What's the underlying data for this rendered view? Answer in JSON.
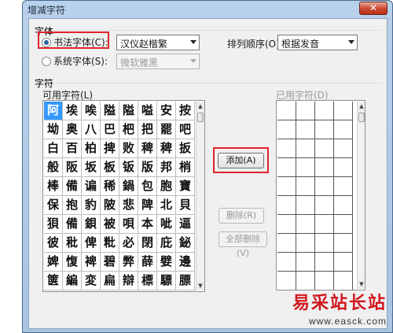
{
  "window": {
    "title": "增减字符",
    "close_label": "✕"
  },
  "font_group": {
    "label": "字体",
    "calligraphy_radio": {
      "label": "书法字体(C):",
      "checked": true
    },
    "calligraphy_select": {
      "value": "汉仪赵楷繁"
    },
    "system_radio": {
      "label": "系统字体(S):",
      "checked": false
    },
    "system_select": {
      "value": "微软雅黑"
    },
    "sort_label": "排列顺序(O):",
    "sort_select": {
      "value": "根据发音"
    }
  },
  "char_group": {
    "label": "字符",
    "available_label": "可用字符(L)",
    "used_label": "已用字符(D)",
    "available_chars": [
      [
        "阿",
        "埃",
        "唉",
        "隘",
        "隘",
        "嗌",
        "安",
        "按"
      ],
      [
        "坳",
        "奥",
        "八",
        "巴",
        "杷",
        "把",
        "罷",
        "吧"
      ],
      [
        "白",
        "百",
        "柏",
        "捭",
        "败",
        "稗",
        "稗",
        "扳"
      ],
      [
        "般",
        "阪",
        "坂",
        "板",
        "钣",
        "版",
        "邦",
        "梢"
      ],
      [
        "棒",
        "備",
        "谝",
        "稀",
        "鍋",
        "包",
        "胞",
        "寶"
      ],
      [
        "保",
        "抱",
        "豹",
        "陂",
        "悲",
        "陴",
        "北",
        "貝"
      ],
      [
        "狽",
        "備",
        "鋇",
        "被",
        "唄",
        "本",
        "呲",
        "逼"
      ],
      [
        "彼",
        "秕",
        "俾",
        "粃",
        "必",
        "閉",
        "庇",
        "鉍"
      ],
      [
        "婢",
        "愎",
        "裨",
        "碧",
        "弊",
        "薛",
        "嬖",
        "邊"
      ],
      [
        "箧",
        "編",
        "変",
        "扁",
        "辯",
        "標",
        "驃",
        "膘"
      ]
    ]
  },
  "buttons": {
    "add": "添加(A)",
    "delete": "删除(R)",
    "delete_all": "全部删除(V)"
  },
  "watermark": {
    "logo": "易采站长站",
    "url": "www.easck.com"
  },
  "colors": {
    "highlight_red": "#e0232a",
    "selection_blue": "#3399ff"
  }
}
